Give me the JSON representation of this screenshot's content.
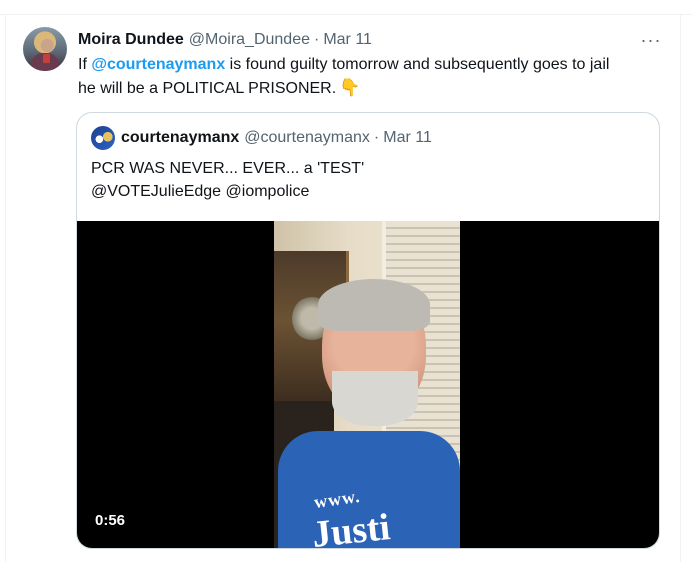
{
  "tweet": {
    "display_name": "Moira Dundee",
    "handle": "@Moira_Dundee",
    "separator": "·",
    "date": "Mar 11",
    "more_icon": "···",
    "text_prefix": "If ",
    "mention": "@courtenaymanx",
    "text_line1_rest": " is found guilty tomorrow and subsequently goes to jail",
    "text_line2": "he will be a POLITICAL PRISONER.",
    "emoji": "👇"
  },
  "quote": {
    "display_name": "courtenaymanx",
    "handle": "@courtenaymanx",
    "separator": "·",
    "date": "Mar 11",
    "text_line1": "PCR WAS NEVER... EVER... a 'TEST'",
    "text_line2": "@VOTEJulieEdge @iompolice",
    "video": {
      "duration": "0:56",
      "shirt_text_top": "www.",
      "shirt_text_bottom": "Justi"
    }
  },
  "colors": {
    "link": "#1d9bf0",
    "secondary_text": "#536471",
    "border": "#cfd9de"
  }
}
